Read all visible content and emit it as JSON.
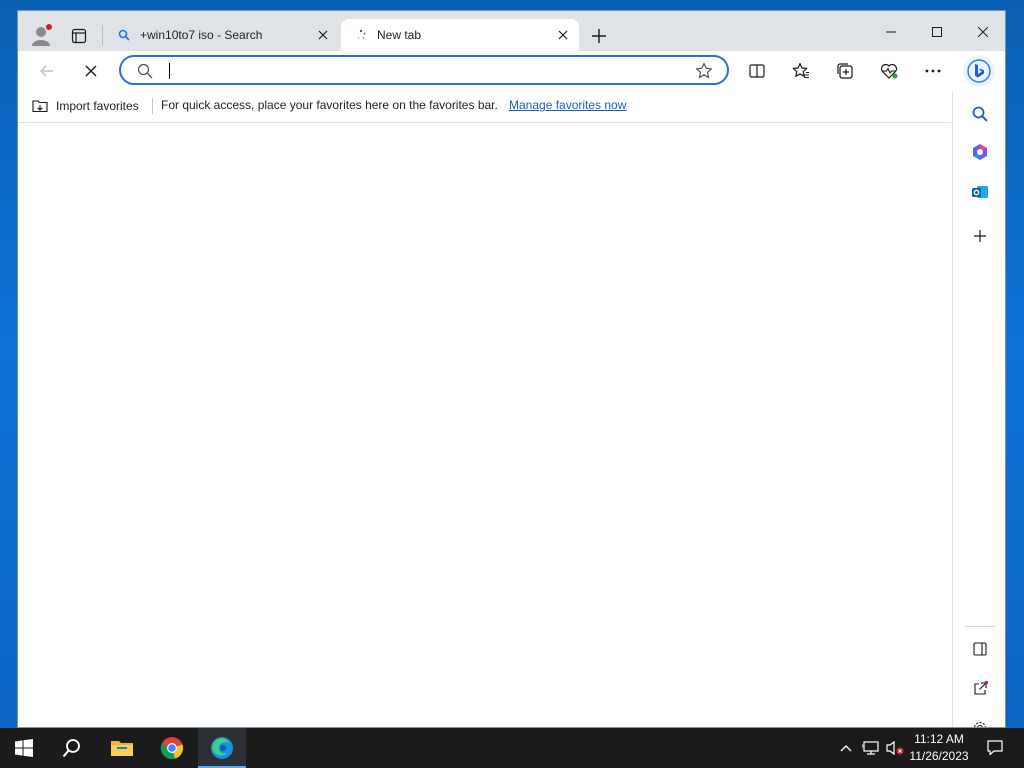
{
  "browser": {
    "tabs": [
      {
        "label": "+win10to7 iso - Search",
        "favicon": "search-icon",
        "active": false
      },
      {
        "label": "New tab",
        "favicon": "loading-spinner-icon",
        "active": true
      }
    ],
    "window_controls": [
      "minimize-icon",
      "maximize-icon",
      "close-icon"
    ]
  },
  "toolbar": {
    "address": {
      "value": "",
      "placeholder": ""
    },
    "buttons": [
      "back-icon",
      "stop-loading-icon",
      "favorite-star-icon",
      "split-screen-icon",
      "favorites-icon",
      "collections-icon",
      "browser-essentials-icon",
      "more-icon",
      "copilot-icon"
    ]
  },
  "favorites_bar": {
    "import_label": "Import favorites",
    "message": "For quick access, place your favorites here on the favorites bar.",
    "link": "Manage favorites now"
  },
  "sidebar": {
    "items": [
      "search-icon",
      "microsoft365-icon",
      "outlook-icon",
      "add-icon",
      "panel-icon",
      "open-external-icon",
      "settings-icon"
    ]
  },
  "taskbar": {
    "apps": [
      "start-icon",
      "search-icon",
      "file-explorer-icon",
      "chrome-icon",
      "edge-icon"
    ],
    "time": "11:12 AM",
    "date": "11/26/2023"
  },
  "colors": {
    "accent": "#2a6fd6",
    "link": "#1a5fb4",
    "taskbar": "#1b1b1c"
  }
}
